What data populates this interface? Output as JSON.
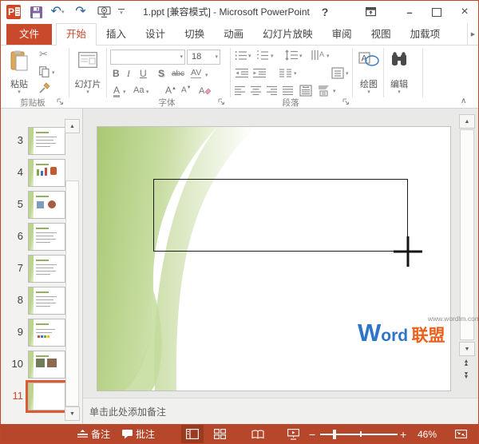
{
  "accent": "#C8492B",
  "titlebar": {
    "title": "1.ppt [兼容模式] - Microsoft PowerPoint"
  },
  "tabs": [
    {
      "label": "文件",
      "file": true
    },
    {
      "label": "开始",
      "selected": true
    },
    {
      "label": "插入"
    },
    {
      "label": "设计"
    },
    {
      "label": "切换"
    },
    {
      "label": "动画"
    },
    {
      "label": "幻灯片放映"
    },
    {
      "label": "审阅"
    },
    {
      "label": "视图"
    },
    {
      "label": "加载项"
    }
  ],
  "ribbon": {
    "paste_label": "粘贴",
    "slide_label": "幻灯片",
    "clipboard_label": "剪贴板",
    "font_label": "字体",
    "paragraph_label": "段落",
    "drawing_label": "绘图",
    "editing_label": "编辑",
    "font_name_value": "",
    "font_size_value": "18",
    "bold": "B",
    "italic": "I",
    "underline": "U",
    "shadow": "S",
    "strike": "abc",
    "charspace": "AV",
    "fontcolor": "A",
    "changecase": "Aa",
    "grow": "A",
    "shrink": "A"
  },
  "slides_panel": {
    "thumbnails": [
      {
        "num": "3",
        "kind": "text"
      },
      {
        "num": "4",
        "kind": "chart"
      },
      {
        "num": "5",
        "kind": "images"
      },
      {
        "num": "6",
        "kind": "text"
      },
      {
        "num": "7",
        "kind": "text"
      },
      {
        "num": "8",
        "kind": "text"
      },
      {
        "num": "9",
        "kind": "colortext"
      },
      {
        "num": "10",
        "kind": "images2"
      },
      {
        "num": "11",
        "kind": "blank",
        "selected": true
      }
    ]
  },
  "canvas": {
    "watermark_url": "www.wordlm.com",
    "watermark_w": "W",
    "watermark_ord": "ord",
    "watermark_cn": "联盟"
  },
  "notes_placeholder": "单击此处添加备注",
  "statusbar": {
    "notes": "备注",
    "comments": "批注",
    "zoom": "46%"
  },
  "icons": {
    "dropdown": "▾",
    "scissors": "✂",
    "undo-arrow": "↶",
    "redo-arrow": "↷",
    "scroll-up": "▲",
    "scroll-down": "▼",
    "tab-scroll-right": "▶",
    "collapse-ribbon": "∧",
    "close-glyph": "×",
    "minimize-glyph": "–",
    "help-glyph": "?",
    "zoom-out-glyph": "−",
    "zoom-in-glyph": "+"
  }
}
